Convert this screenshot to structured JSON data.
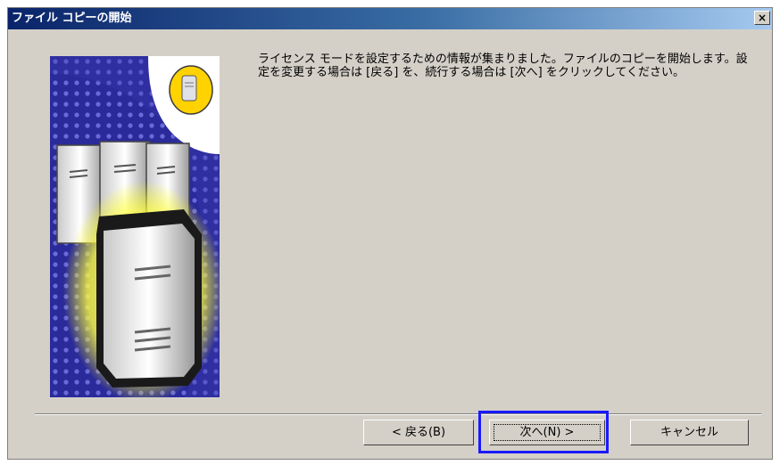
{
  "window": {
    "title": "ファイル コピーの開始",
    "close_label": "×"
  },
  "message": "ライセンス モードを設定するための情報が集まりました。ファイルのコピーを開始します。設定を変更する場合は [戻る] を、続行する場合は [次へ] をクリックしてください。",
  "buttons": {
    "back": "< 戻る(B)",
    "next": "次へ(N) >",
    "cancel": "キャンセル"
  },
  "colors": {
    "dialog_bg": "#d4d0c8",
    "title_start": "#0a246a",
    "title_end": "#a6caf0",
    "highlight": "#1a1aff"
  },
  "icons": [
    "server-illustration",
    "server-badge-icon",
    "close-icon"
  ]
}
